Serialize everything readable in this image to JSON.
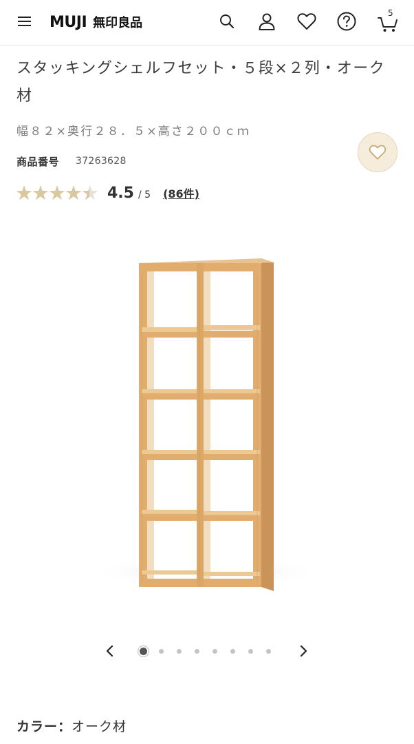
{
  "header": {
    "logo_en": "MUJI",
    "logo_jp": "無印良品",
    "menu_icon": "hamburger-menu-icon",
    "search_icon": "search-icon",
    "account_icon": "person-icon",
    "favorites_icon": "heart-icon",
    "help_icon": "question-circle-icon",
    "cart_icon": "cart-icon",
    "cart_count": "5"
  },
  "product": {
    "title": "スタッキングシェルフセット・５段×２列・オーク材",
    "spec": "幅８２×奥行２８．５×高さ２００ｃｍ",
    "code_label": "商品番号",
    "code_value": "37263628",
    "rating": {
      "value": "4.5",
      "max": "/ 5",
      "stars_fraction": 0.9,
      "reviews": "(86件)"
    },
    "favorite_icon": "heart-outline-icon",
    "image_alt": "stacking-shelf-oak-5x2"
  },
  "carousel": {
    "total": 8,
    "active_index": 0,
    "prev_icon": "chevron-left-icon",
    "next_icon": "chevron-right-icon"
  },
  "color": {
    "label": "カラー：",
    "value": "オーク材"
  },
  "colors": {
    "star_filled": "#d9c7a0",
    "star_empty": "#e6e1d8",
    "fav_bg": "#f5ecdc",
    "wood": "#e2b276"
  }
}
